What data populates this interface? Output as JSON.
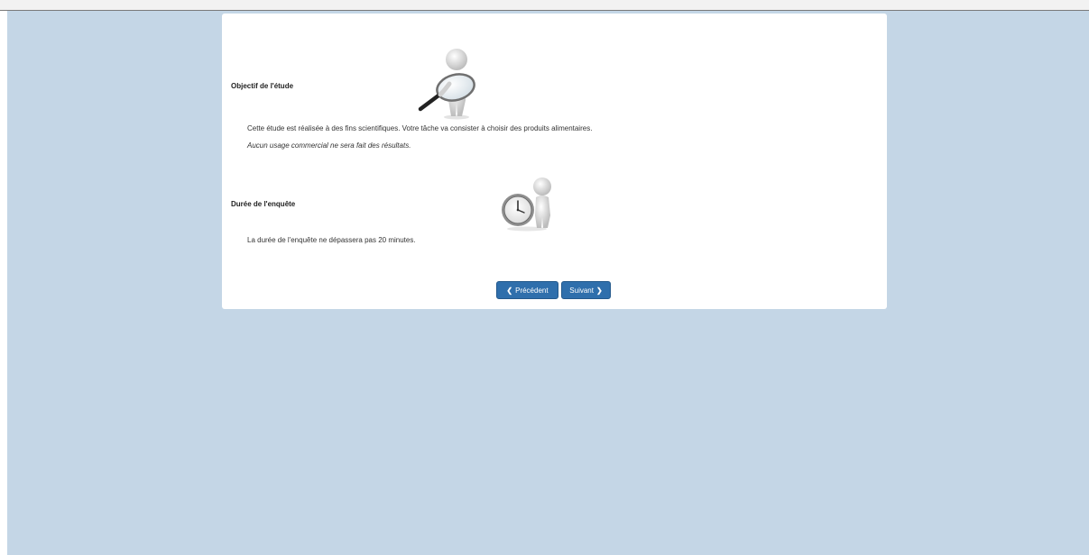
{
  "sections": [
    {
      "title": "Objectif de l'étude",
      "text": "Cette étude est réalisée à des fins scientifiques. Votre tâche va consister à choisir des produits alimentaires.",
      "note": "Aucun usage commercial ne sera fait des résultats."
    },
    {
      "title": "Durée de l'enquête",
      "text": "La durée de l'enquête ne dépassera pas 20 minutes."
    }
  ],
  "nav": {
    "prev_label": "Précédent",
    "next_label": "Suivant",
    "prev_icon": "chevron-left-icon",
    "next_icon": "chevron-right-icon"
  },
  "colors": {
    "background": "#c4d6e6",
    "button": "#2f6fac"
  }
}
